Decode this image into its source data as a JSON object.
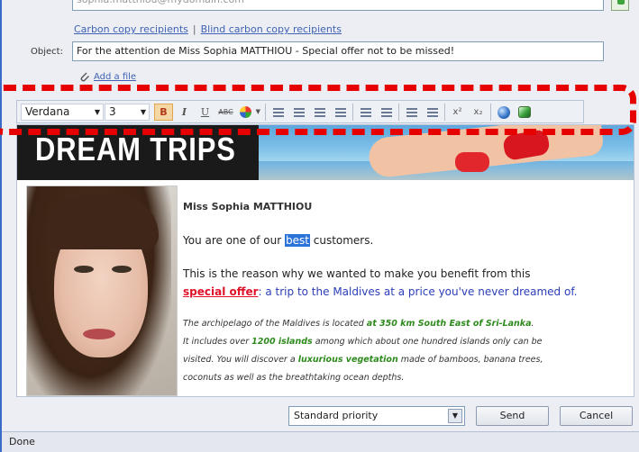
{
  "compose": {
    "to_value": "sophia.matthiou@mydomain.com",
    "cc_link": "Carbon copy recipients",
    "cc_separator": "|",
    "bcc_link": "Blind carbon copy recipients",
    "object_label": "Object:",
    "object_value": "For the attention de Miss Sophia MATTHIOU - Special offer not to be missed!",
    "attach_label": "Add a file"
  },
  "toolbar": {
    "font_family": "Verdana",
    "font_size": "3",
    "bold": "B",
    "italic": "I",
    "underline": "U",
    "strikethrough": "ABC",
    "superscript": "x²",
    "subscript": "x₂"
  },
  "banner": {
    "logo": "DREAM TRIPS"
  },
  "message": {
    "name": "Miss Sophia MATTHIOU",
    "line1_before": "You are one of our ",
    "line1_highlight": "best",
    "line1_after": " customers.",
    "reason_line": "This is the reason why we wanted to make you benefit from this",
    "offer_link": "special offer",
    "offer_rest": ": a trip to the Maldives at a price you've never dreamed of.",
    "p1_a": "The archipelago of the Maldives is located ",
    "p1_b": "at 350 km South East of Sri-Lanka",
    "p1_c": ".",
    "p2_a": "It includes over ",
    "p2_b": "1200 islands",
    "p2_c": " among which about one hundred islands only can be",
    "p3_a": "visited. You will discover a ",
    "p3_b": "luxurious vegetation",
    "p3_c": " made of bamboos, banana trees,",
    "p4": "coconuts as well as the breathtaking ocean depths."
  },
  "footer": {
    "priority": "Standard priority",
    "send": "Send",
    "cancel": "Cancel"
  },
  "status": "Done",
  "colors": {
    "highlight_border": "#e60000",
    "link": "#3f62b5",
    "offer": "#e0122a",
    "accent_green": "#2e8a1d"
  }
}
